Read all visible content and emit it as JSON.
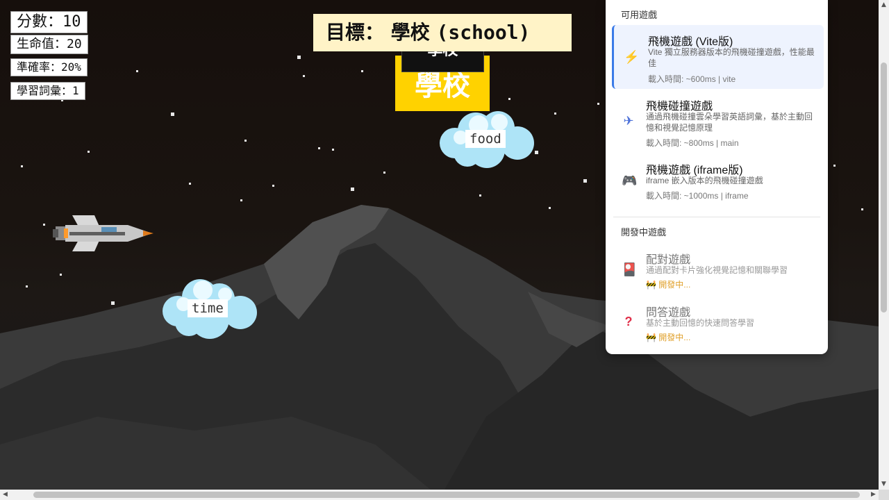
{
  "hud": {
    "score_label": "分數：",
    "score_value": "10",
    "lives_label": "生命值：",
    "lives_value": "20",
    "accuracy_label": "準確率：",
    "accuracy_value": "20%",
    "vocab_label": "學習詞彙：",
    "vocab_value": "1"
  },
  "target": {
    "label": "目標：",
    "word_zh": "學校",
    "word_en": "(school)"
  },
  "falling_word": {
    "tag": "學校",
    "big": "學校"
  },
  "clouds": [
    {
      "word": "food"
    },
    {
      "word": "time"
    }
  ],
  "menu": {
    "available_title": "可用遊戲",
    "available": [
      {
        "icon": "lightning-icon",
        "name": "飛機遊戲 (Vite版)",
        "desc": "Vite 獨立服務器版本的飛機碰撞遊戲，性能最佳",
        "meta": "載入時間: ~600ms | vite"
      },
      {
        "icon": "airplane-icon",
        "name": "飛機碰撞遊戲",
        "desc": "通過飛機碰撞雲朵學習英語詞彙，基於主動回憶和視覺記憶原理",
        "meta": "載入時間: ~800ms | main"
      },
      {
        "icon": "gamepad-icon",
        "name": "飛機遊戲 (iframe版)",
        "desc": "iframe 嵌入版本的飛機碰撞遊戲",
        "meta": "載入時間: ~1000ms | iframe"
      }
    ],
    "dev_title": "開發中遊戲",
    "in_dev": [
      {
        "icon": "cards-icon",
        "name": "配對遊戲",
        "desc": "通過配對卡片強化視覺記憶和關聯學習",
        "meta": "🚧 開發中..."
      },
      {
        "icon": "question-icon",
        "name": "問答遊戲",
        "desc": "基於主動回憶的快速問答學習",
        "meta": "🚧 開發中..."
      }
    ]
  },
  "colors": {
    "word_box": "#ffd200",
    "target_bg": "#fff3c7",
    "active_accent": "#3b7be8"
  }
}
